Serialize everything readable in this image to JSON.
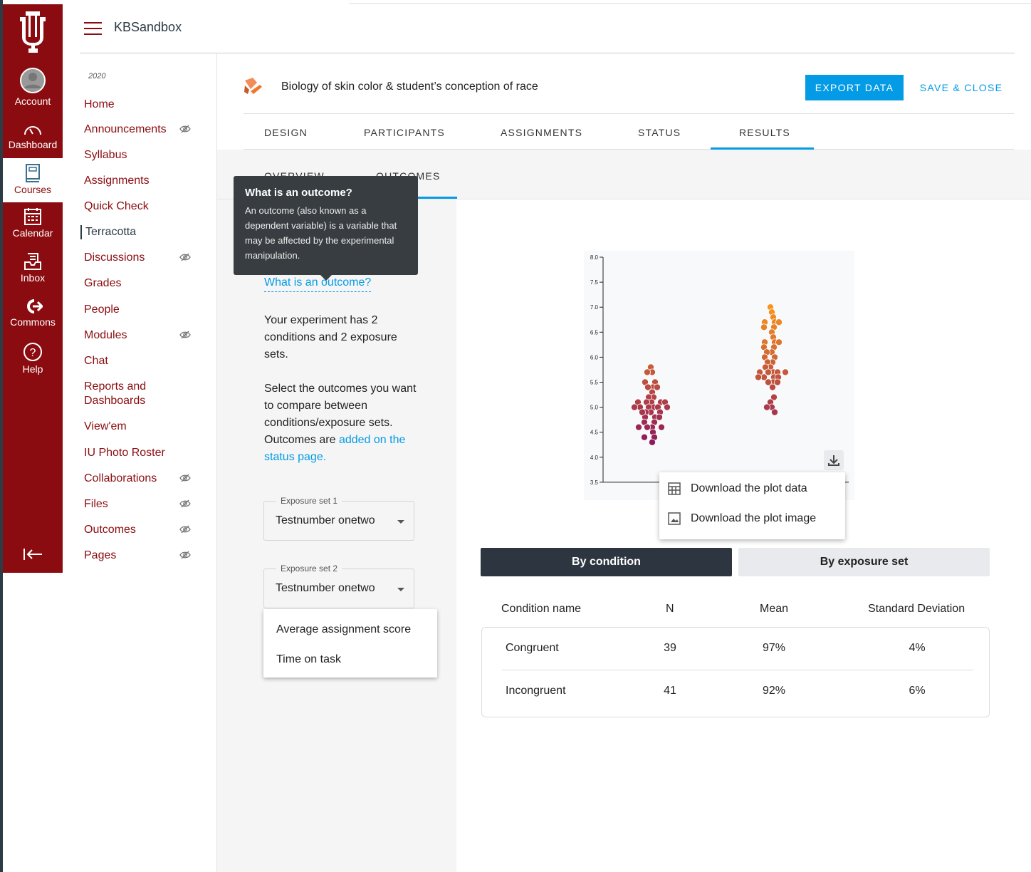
{
  "global_nav": {
    "logo": "IU trident logo",
    "items": [
      {
        "label": "Account",
        "icon": "avatar-icon"
      },
      {
        "label": "Dashboard",
        "icon": "dashboard-icon"
      },
      {
        "label": "Courses",
        "icon": "courses-icon",
        "active": true
      },
      {
        "label": "Calendar",
        "icon": "calendar-icon"
      },
      {
        "label": "Inbox",
        "icon": "inbox-icon"
      },
      {
        "label": "Commons",
        "icon": "commons-icon"
      },
      {
        "label": "Help",
        "icon": "help-icon"
      }
    ],
    "collapse_icon": "collapse-arrow-icon"
  },
  "header": {
    "course": "KBSandbox",
    "menu_icon": "hamburger-icon"
  },
  "course_nav": {
    "term": "2020",
    "items": [
      {
        "label": "Home"
      },
      {
        "label": "Announcements",
        "hidden": true
      },
      {
        "label": "Syllabus"
      },
      {
        "label": "Assignments"
      },
      {
        "label": "Quick Check"
      },
      {
        "label": "Terracotta",
        "active": true
      },
      {
        "label": "Discussions",
        "hidden": true
      },
      {
        "label": "Grades"
      },
      {
        "label": "People"
      },
      {
        "label": "Modules",
        "hidden": true
      },
      {
        "label": "Chat"
      },
      {
        "label": "Reports and Dashboards"
      },
      {
        "label": "View'em"
      },
      {
        "label": "IU Photo Roster"
      },
      {
        "label": "Collaborations",
        "hidden": true
      },
      {
        "label": "Files",
        "hidden": true
      },
      {
        "label": "Outcomes",
        "hidden": true
      },
      {
        "label": "Pages",
        "hidden": true
      }
    ]
  },
  "app": {
    "title": "Biology of skin color & student’s conception of race",
    "export": "EXPORT DATA",
    "save": "SAVE & CLOSE",
    "tabs": [
      "DESIGN",
      "PARTICIPANTS",
      "ASSIGNMENTS",
      "STATUS",
      "RESULTS"
    ],
    "active_tab": "RESULTS",
    "subtabs": [
      "OVERVIEW",
      "OUTCOMES"
    ],
    "active_subtab": "OUTCOMES",
    "accent": "#039be5"
  },
  "tooltip": {
    "title": "What is an outcome?",
    "body": "An outcome (also known as a dependent variable) is a variable that may be affected by the experimental manipulation."
  },
  "panel": {
    "link": "What is an outcome?",
    "p1": "Your experiment has 2 conditions and 2 exposure sets.",
    "p2": "Select the outcomes you want to compare between conditions/exposure sets. Outcomes are ",
    "p2_link": "added on the status page.",
    "exposure1": {
      "label": "Exposure set 1",
      "value": "Testnumber onetwo"
    },
    "exposure2": {
      "label": "Exposure set 2",
      "value": "Testnumber onetwo"
    },
    "dropdown_options": [
      "Average assignment score",
      "Time on task"
    ]
  },
  "download_menu": [
    "Download the plot data",
    "Download the plot image"
  ],
  "toggle": {
    "by_condition": "By condition",
    "by_exposure": "By exposure set",
    "active": "By condition"
  },
  "table": {
    "headers": [
      "Condition name",
      "N",
      "Mean",
      "Standard Deviation"
    ],
    "rows": [
      [
        "Congruent",
        "39",
        "97%",
        "4%"
      ],
      [
        "Incongruent",
        "41",
        "92%",
        "6%"
      ]
    ]
  },
  "chart_data": {
    "type": "scatter",
    "ylim": [
      3.5,
      8.0
    ],
    "yticks": [
      "3.5",
      "4.0",
      "4.5",
      "5.0",
      "5.5",
      "6.0",
      "6.5",
      "7.0",
      "7.5",
      "8.0"
    ],
    "color_low": "#8e1b5c",
    "color_high": "#f7941d",
    "grid": false,
    "series": [
      {
        "values": [
          5.8,
          5.7,
          5.7,
          5.5,
          5.5,
          5.4,
          5.4,
          5.4,
          5.3,
          5.2,
          5.2,
          5.1,
          5.1,
          5.1,
          5.1,
          5.1,
          5.0,
          5.0,
          5.0,
          5.0,
          5.0,
          4.9,
          4.9,
          4.9,
          4.8,
          4.8,
          4.8,
          4.7,
          4.7,
          4.6,
          4.6,
          4.6,
          4.6,
          4.5,
          4.4,
          4.4,
          4.3,
          5.0,
          4.9
        ]
      },
      {
        "values": [
          7.0,
          6.9,
          6.8,
          6.7,
          6.7,
          6.7,
          6.6,
          6.6,
          6.5,
          6.4,
          6.3,
          6.3,
          6.3,
          6.2,
          6.2,
          6.1,
          6.1,
          6.0,
          6.0,
          5.9,
          5.9,
          5.8,
          5.8,
          5.7,
          5.7,
          5.7,
          5.7,
          5.6,
          5.6,
          5.6,
          5.5,
          5.5,
          5.5,
          5.4,
          5.2,
          5.1,
          5.0,
          5.0,
          4.9,
          5.6,
          5.7
        ]
      }
    ]
  }
}
